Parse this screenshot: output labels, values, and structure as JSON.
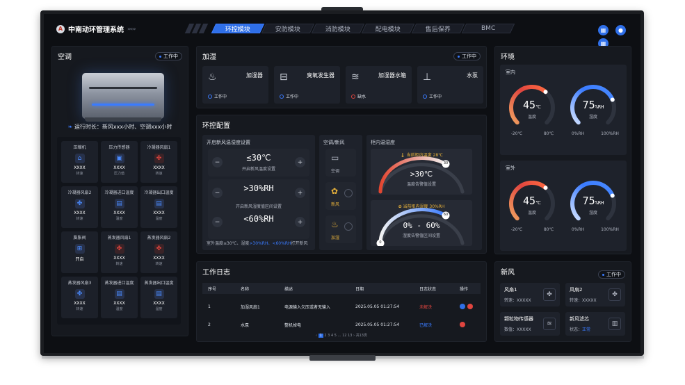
{
  "app": {
    "title": "中南动环管理系统",
    "logo_text": "A"
  },
  "tabs": [
    {
      "label": "环控模块",
      "active": true
    },
    {
      "label": "安防模块"
    },
    {
      "label": "消防模块"
    },
    {
      "label": "配电模块"
    },
    {
      "label": "售后保养"
    },
    {
      "label": "BMC"
    }
  ],
  "header_icons": [
    "grid-icon",
    "user-icon",
    "apps-icon"
  ],
  "ac": {
    "title": "空调",
    "status": "工作中",
    "runtime": "运行时长：新风xxx小时、空调xxx小时",
    "sensors": [
      {
        "name": "压缩机",
        "value": "XXXX",
        "unit": "转速",
        "icon": "compressor-icon",
        "tone": "blue"
      },
      {
        "name": "压力传感器",
        "value": "XXXX",
        "unit": "压力值",
        "icon": "pressure-icon",
        "tone": "blue"
      },
      {
        "name": "冷凝器风扇1",
        "value": "XXXX",
        "unit": "转速",
        "icon": "fan-icon",
        "tone": "red"
      },
      {
        "name": "冷凝器风扇2",
        "value": "XXXX",
        "unit": "转速",
        "icon": "fan-icon",
        "tone": "blue"
      },
      {
        "name": "冷凝器进口温度",
        "value": "XXXX",
        "unit": "温度",
        "icon": "thermo-icon",
        "tone": "blue"
      },
      {
        "name": "冷凝器出口温度",
        "value": "XXXX",
        "unit": "温度",
        "icon": "thermo-icon",
        "tone": "blue"
      },
      {
        "name": "膨胀阀",
        "value": "开启",
        "unit": "",
        "icon": "valve-icon",
        "tone": "blue"
      },
      {
        "name": "蒸发器风扇1",
        "value": "XXXX",
        "unit": "转速",
        "icon": "fan-icon",
        "tone": "red"
      },
      {
        "name": "蒸发器风扇2",
        "value": "XXXX",
        "unit": "转速",
        "icon": "fan-icon",
        "tone": "red"
      },
      {
        "name": "蒸发器风扇3",
        "value": "XXXX",
        "unit": "转速",
        "icon": "fan-icon",
        "tone": "blue"
      },
      {
        "name": "蒸发器进口温度",
        "value": "XXXX",
        "unit": "温度",
        "icon": "thermo-icon",
        "tone": "blue"
      },
      {
        "name": "蒸发器出口温度",
        "value": "XXXX",
        "unit": "温度",
        "icon": "thermo-icon",
        "tone": "blue"
      }
    ]
  },
  "humid": {
    "title": "加湿",
    "status": "工作中",
    "cards": [
      {
        "name": "加湿器",
        "status": "工作中",
        "icon": "humidifier-icon",
        "alarm": false
      },
      {
        "name": "臭氧发生器",
        "status": "工作中",
        "icon": "ozone-icon",
        "alarm": false
      },
      {
        "name": "加湿器水箱",
        "status": "缺水",
        "icon": "water-tank-icon",
        "alarm": true
      },
      {
        "name": "水泵",
        "status": "工作中",
        "icon": "pump-icon",
        "alarm": false
      }
    ]
  },
  "climate": {
    "title": "环控配置",
    "left_title": "开启新风温湿度设置",
    "controls": [
      {
        "value": "≤30℃",
        "label": "开启新风温度设置"
      },
      {
        "value": ">30%RH",
        "label": "开启新风湿度值区间设置"
      },
      {
        "value": "<60%RH",
        "label": ""
      }
    ],
    "footer": {
      "p1": "室外温度≤30℃、湿度",
      "p2": ">30%RH、<60%RH",
      "p3": "打开新风"
    },
    "mode_title": "空调/新风",
    "modes": [
      {
        "label": "空调",
        "icon": "ac-icon",
        "active": false
      },
      {
        "label": "新风",
        "icon": "fan-icon",
        "active": true
      },
      {
        "label": "加湿",
        "icon": "humidifier-icon",
        "active": true
      }
    ],
    "cab_title": "柜内温湿度",
    "cab_temp": {
      "label": "当前柜内温度 28℃",
      "badge": "30",
      "value": ">30℃",
      "caption": "温度告警值设置"
    },
    "cab_hum": {
      "label": "当前柜内湿度 30%RH",
      "badge_l": "0",
      "badge_r": "60",
      "value": "0% - 60%",
      "caption": "湿度告警值区间设置"
    }
  },
  "env": {
    "title": "环境",
    "indoor": {
      "title": "室内",
      "temp": "45",
      "temp_unit": "℃",
      "temp_label": "温度",
      "temp_min": "-20℃",
      "temp_max": "80℃",
      "temp_frac": 0.65,
      "hum": "75",
      "hum_unit": "%RH",
      "hum_label": "湿度",
      "hum_min": "0%RH",
      "hum_max": "100%RH",
      "hum_frac": 0.75
    },
    "outdoor": {
      "title": "室外",
      "temp": "45",
      "temp_unit": "℃",
      "temp_label": "温度",
      "temp_min": "-20℃",
      "temp_max": "80℃",
      "temp_frac": 0.65,
      "hum": "75",
      "hum_unit": "%RH",
      "hum_label": "湿度",
      "hum_min": "0%RH",
      "hum_max": "100%RH",
      "hum_frac": 0.75
    }
  },
  "log": {
    "title": "工作日志",
    "columns": [
      "序号",
      "名称",
      "描述",
      "日期",
      "日志状态",
      "操作"
    ],
    "rows": [
      {
        "no": "1",
        "name": "加湿风扇1",
        "desc": "电源输入欠压或者无输入",
        "date": "2025.05.05  01:27:54",
        "status": "未解决",
        "status_color": "#e0453f"
      },
      {
        "no": "2",
        "name": "水泵",
        "desc": "整机掉电",
        "date": "2025.05.05  01:27:54",
        "status": "已解决",
        "status_color": "#3a7bff"
      }
    ],
    "pager": {
      "prev": "‹",
      "active": "1",
      "pages": "2  3  4  5  …  12  13",
      "next": "›",
      "total": "共13页"
    }
  },
  "fresh": {
    "title": "新风",
    "status": "工作中",
    "cards": [
      {
        "name": "风扇1",
        "value": "转速：XXXXX",
        "icon": "fan-icon"
      },
      {
        "name": "风扇2",
        "value": "转速：XXXXX",
        "icon": "fan-icon"
      },
      {
        "name": "颗粒物传感器",
        "value": "数值：XXXXX",
        "icon": "particle-icon"
      },
      {
        "name": "新风滤芯",
        "value_label": "状态：",
        "value": "正常",
        "icon": "filter-icon"
      }
    ]
  },
  "colors": {
    "accent": "#2f6fe8",
    "alarm": "#e0453f",
    "panel": "#16191f"
  }
}
